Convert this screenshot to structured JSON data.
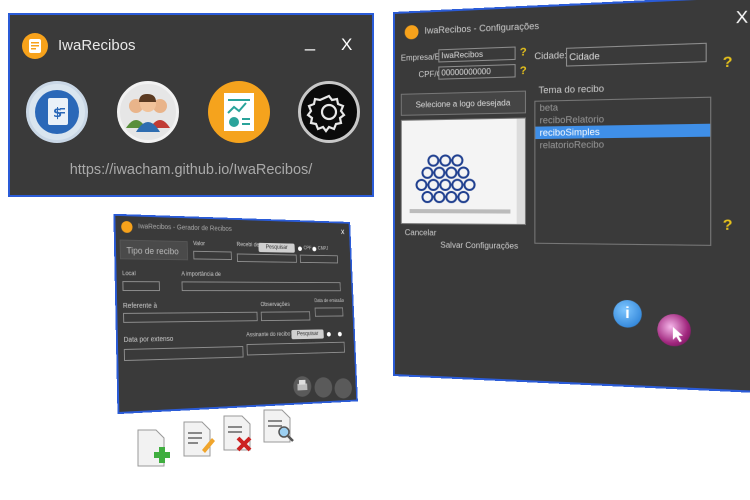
{
  "main_window": {
    "title": "IwaRecibos",
    "minimize_label": "_",
    "close_label": "X",
    "url": "https://iwacham.github.io/IwaRecibos/",
    "colors": {
      "accent": "#f7a21b",
      "window_bg": "#3a3a3a",
      "border": "#2a5bd7"
    }
  },
  "config_window": {
    "title": "IwaRecibos - Configurações",
    "close_label": "X",
    "empresa_label": "Empresa/Emissor:",
    "empresa_value": "IwaRecibos",
    "cpf_label": "CPF/CNPJ:",
    "cpf_value": "00000000000",
    "cidade_label": "Cidade:",
    "cidade_value": "Cidade",
    "tema_label": "Tema do recibo",
    "logo_button": "Selecione a logo desejada",
    "cancel_label": "Cancelar",
    "save_label": "Salvar Configurações",
    "help_mark": "?",
    "themes": [
      "beta",
      "reciboRelatorio",
      "reciboSimples",
      "relatorioRecibo"
    ],
    "selected_theme": "reciboSimples"
  },
  "gen_window": {
    "title": "IwaRecibos - Gerador de Recibos",
    "close_label": "x",
    "tipo_label": "Tipo de recibo",
    "valor_label": "Valor",
    "recebi_label": "Recebi de",
    "pesquisar_label": "Pesquisar cliente",
    "cpf_label": "CPF",
    "cnpj_label": "CNPJ",
    "local_label": "Local",
    "importancia_label": "A importância de",
    "referente_label": "Referente à",
    "observacoes_label": "Observações",
    "data_emissao_label": "Data de emissão",
    "data_extenso_label": "Data por extenso",
    "assinante_label": "Assinante do recibo"
  }
}
